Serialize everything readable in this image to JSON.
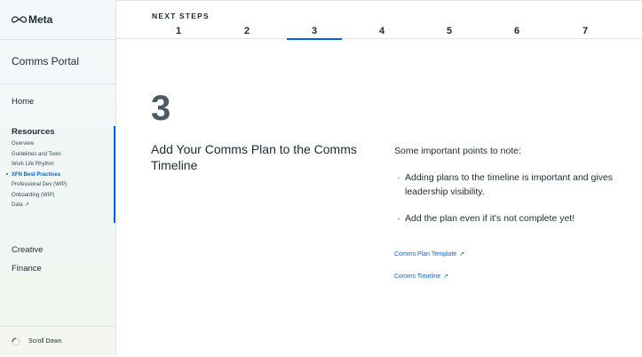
{
  "brand": {
    "name": "Meta",
    "accent": "#0064e0"
  },
  "sidebar": {
    "portal_title": "Comms Portal",
    "home": "Home",
    "resources": {
      "label": "Resources",
      "items": [
        {
          "label": "Overview"
        },
        {
          "label": "Guidelines and Tools"
        },
        {
          "label": "Work Life Rhythm"
        },
        {
          "label": "XFN Best Practices",
          "active": true
        },
        {
          "label": "Professional Dev (WIP)"
        },
        {
          "label": "Onboarding (WIP)"
        },
        {
          "label": "Data",
          "external": true
        }
      ]
    },
    "creative": "Creative",
    "finance": "Finance",
    "scroll_label": "Scroll Down"
  },
  "next_steps": {
    "label": "NEXT STEPS",
    "steps": [
      "1",
      "2",
      "3",
      "4",
      "5",
      "6",
      "7"
    ],
    "active_step": "3"
  },
  "content": {
    "step_number": "3",
    "heading": "Add Your Comms Plan to the Comms Timeline",
    "points_title": "Some important points to note:",
    "points": [
      "Adding plans to the timeline is important and gives leadership visibility.",
      "Add the plan even if it's not complete yet!"
    ],
    "links": [
      {
        "label": "Comms Plan Template",
        "icon": "external-arrow-icon"
      },
      {
        "label": "Comms Timeline",
        "icon": "external-arrow-icon"
      }
    ]
  }
}
